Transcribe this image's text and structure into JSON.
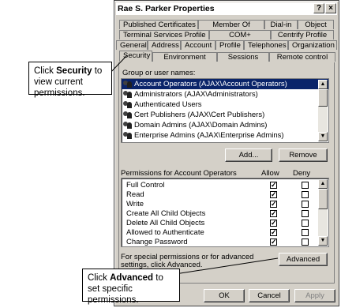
{
  "window": {
    "title": "Rae S. Parker Properties",
    "help_label": "?",
    "close_label": "×"
  },
  "tabs": {
    "row1": [
      "Published Certificates",
      "Member Of",
      "Dial-in",
      "Object"
    ],
    "row2": [
      "Terminal Services Profile",
      "COM+",
      "Centrify Profile"
    ],
    "row3": [
      "General",
      "Address",
      "Account",
      "Profile",
      "Telephones",
      "Organization"
    ],
    "row4": [
      "Security",
      "Environment",
      "Sessions",
      "Remote control"
    ],
    "active": "Security"
  },
  "groups": {
    "label": "Group or user names:",
    "items": [
      "Account Operators (AJAX\\Account Operators)",
      "Administrators (AJAX\\Administrators)",
      "Authenticated Users",
      "Cert Publishers (AJAX\\Cert Publishers)",
      "Domain Admins (AJAX\\Domain Admins)",
      "Enterprise Admins (AJAX\\Enterprise Admins)"
    ],
    "add_label": "Add...",
    "remove_label": "Remove"
  },
  "permissions": {
    "label": "Permissions for Account Operators",
    "allow_header": "Allow",
    "deny_header": "Deny",
    "rows": [
      {
        "name": "Full Control",
        "allow": true,
        "deny": false
      },
      {
        "name": "Read",
        "allow": true,
        "deny": false
      },
      {
        "name": "Write",
        "allow": true,
        "deny": false
      },
      {
        "name": "Create All Child Objects",
        "allow": true,
        "deny": false
      },
      {
        "name": "Delete All Child Objects",
        "allow": true,
        "deny": false
      },
      {
        "name": "Allowed to Authenticate",
        "allow": true,
        "deny": false
      },
      {
        "name": "Change Password",
        "allow": true,
        "deny": false
      }
    ]
  },
  "advanced": {
    "text": "For special permissions or for advanced settings, click Advanced.",
    "button_label": "Advanced"
  },
  "footer": {
    "ok_label": "OK",
    "cancel_label": "Cancel",
    "apply_label": "Apply"
  },
  "callouts": {
    "security": {
      "pre": "Click ",
      "bold": "Security",
      "post": " to view current permissions."
    },
    "advanced": {
      "pre": "Click ",
      "bold": "Advanced",
      "post": " to set specific permissions."
    }
  }
}
